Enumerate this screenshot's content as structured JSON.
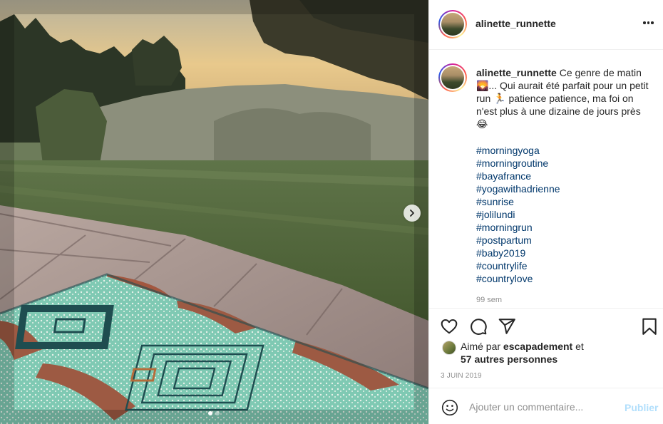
{
  "post": {
    "username": "alinette_runnette",
    "caption": {
      "username": "alinette_runnette",
      "text": "Ce genre de matin 🌄... Qui aurait été parfait pour un petit run 🏃 patience patience, ma foi on n'est plus à une dizaine de jours près 😂",
      "hashtags": [
        "#morningyoga",
        "#morningroutine",
        "#bayafrance",
        "#yogawithadrienne",
        "#sunrise",
        "#jolilundi",
        "#morningrun",
        "#postpartum",
        "#baby2019",
        "#countrylife",
        "#countrylove"
      ],
      "age": "99 sem"
    },
    "likes": {
      "prefix": "Aimé par",
      "liker": "escapadement",
      "conjunction": "et",
      "others": "57 autres personnes"
    },
    "date": "3 JUIN 2019"
  },
  "composer": {
    "placeholder": "Ajouter un commentaire...",
    "publish_label": "Publier"
  },
  "carousel": {
    "slide_count": 2,
    "active_index": 0
  },
  "icons": {
    "like": "heart-icon",
    "comment": "comment-icon",
    "share": "paper-plane-icon",
    "save": "bookmark-icon",
    "more": "more-options-icon",
    "next": "chevron-right-icon",
    "emoji": "smiley-icon"
  },
  "colors": {
    "hashtag": "#00376b",
    "secondary_text": "#8e8e8e",
    "publish_disabled": "#b2dffc"
  }
}
